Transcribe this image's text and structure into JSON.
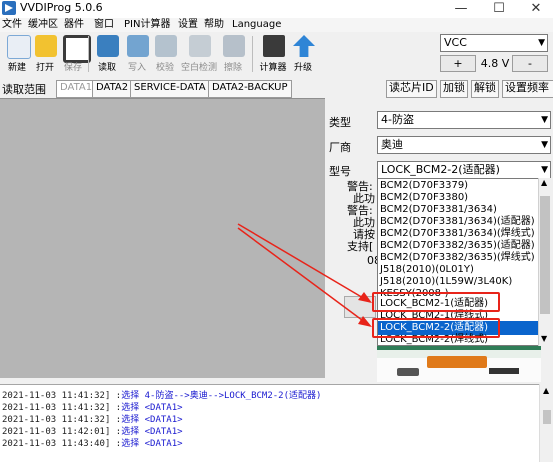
{
  "window": {
    "title": "VVDIProg 5.0.6",
    "minimize": "—",
    "maximize": "☐",
    "close": "✕"
  },
  "menu": [
    "文件",
    "缓冲区",
    "器件",
    "窗口",
    "PIN计算器",
    "设置",
    "帮助",
    "Language"
  ],
  "toolbar": {
    "buttons": [
      {
        "label": "新建",
        "icon": "new-file-icon",
        "color": "#3d8fd6"
      },
      {
        "label": "打开",
        "icon": "open-folder-icon",
        "color": "#f2c230"
      },
      {
        "label": "保存",
        "icon": "save-disk-icon",
        "color": "#3a3a3a"
      },
      {
        "label": "读取",
        "icon": "read-chip-icon",
        "color": "#3a7fbf"
      },
      {
        "label": "写入",
        "icon": "write-chip-icon",
        "color": "#4a8bc5"
      },
      {
        "label": "校验",
        "icon": "verify-icon",
        "color": "#8ca3b8"
      },
      {
        "label": "空白检测",
        "icon": "blank-check-icon",
        "color": "#a9b6c2"
      },
      {
        "label": "擦除",
        "icon": "erase-icon",
        "color": "#8fa0b0"
      },
      {
        "label": "计算器",
        "icon": "calculator-icon",
        "color": "#3a3a3a"
      },
      {
        "label": "升级",
        "icon": "upgrade-arrow-icon",
        "color": "#2f85d6"
      }
    ]
  },
  "voltage": {
    "select_value": "VCC",
    "plus_label": "+",
    "value": "4.8 V",
    "minus_label": "-"
  },
  "read_range": {
    "label": "读取范围",
    "tabs": [
      "DATA1",
      "DATA2",
      "SERVICE-DATA",
      "DATA2-BACKUP"
    ]
  },
  "header_buttons": [
    "读芯片ID",
    "加锁",
    "解锁",
    "设置频率"
  ],
  "right_panel": {
    "type_label": "类型",
    "type_value": "4-防盗",
    "maker_label": "厂商",
    "maker_value": "奥迪",
    "model_label": "型号",
    "model_value": "LOCK_BCM2-2(适配器)",
    "warning_lines": [
      "警告:",
      "此功",
      "警告:",
      "此功",
      "请按",
      "支持[",
      "08"
    ],
    "options": [
      "BCM2(D70F3379)",
      "BCM2(D70F3380)",
      "BCM2(D70F3381/3634)",
      "BCM2(D70F3381/3634)(适配器)",
      "BCM2(D70F3381/3634)(焊线式)",
      "BCM2(D70F3382/3635)(适配器)",
      "BCM2(D70F3382/3635)(焊线式)",
      "J518(2010)(0L01Y)",
      "J518(2010)(1L59W/3L40K)",
      "KESSY(2008-)",
      "LOCK_BCM2-1(适配器)",
      "LOCK_BCM2-1(焊线式)",
      "LOCK_BCM2-2(适配器)",
      "LOCK_BCM2-2(焊线式)"
    ],
    "selected_option": "LOCK_BCM2-2(适配器)"
  },
  "log": [
    {
      "ts": "2021-11-03 11:41:32] :",
      "msg": "选择 4-防盗-->奥迪-->LOCK_BCM2-2(适配器)"
    },
    {
      "ts": "2021-11-03 11:41:32] :",
      "msg": "选择 <DATA1>"
    },
    {
      "ts": "2021-11-03 11:41:32] :",
      "msg": "选择 <DATA1>"
    },
    {
      "ts": "2021-11-03 11:42:01] :",
      "msg": "选择 <DATA1>"
    },
    {
      "ts": "2021-11-03 11:43:40] :",
      "msg": "选择 <DATA1>"
    }
  ],
  "colors": {
    "annotation_red": "#e8241a",
    "selection_blue": "#0a64cc",
    "hex_area_gray": "#b5b5b5"
  }
}
